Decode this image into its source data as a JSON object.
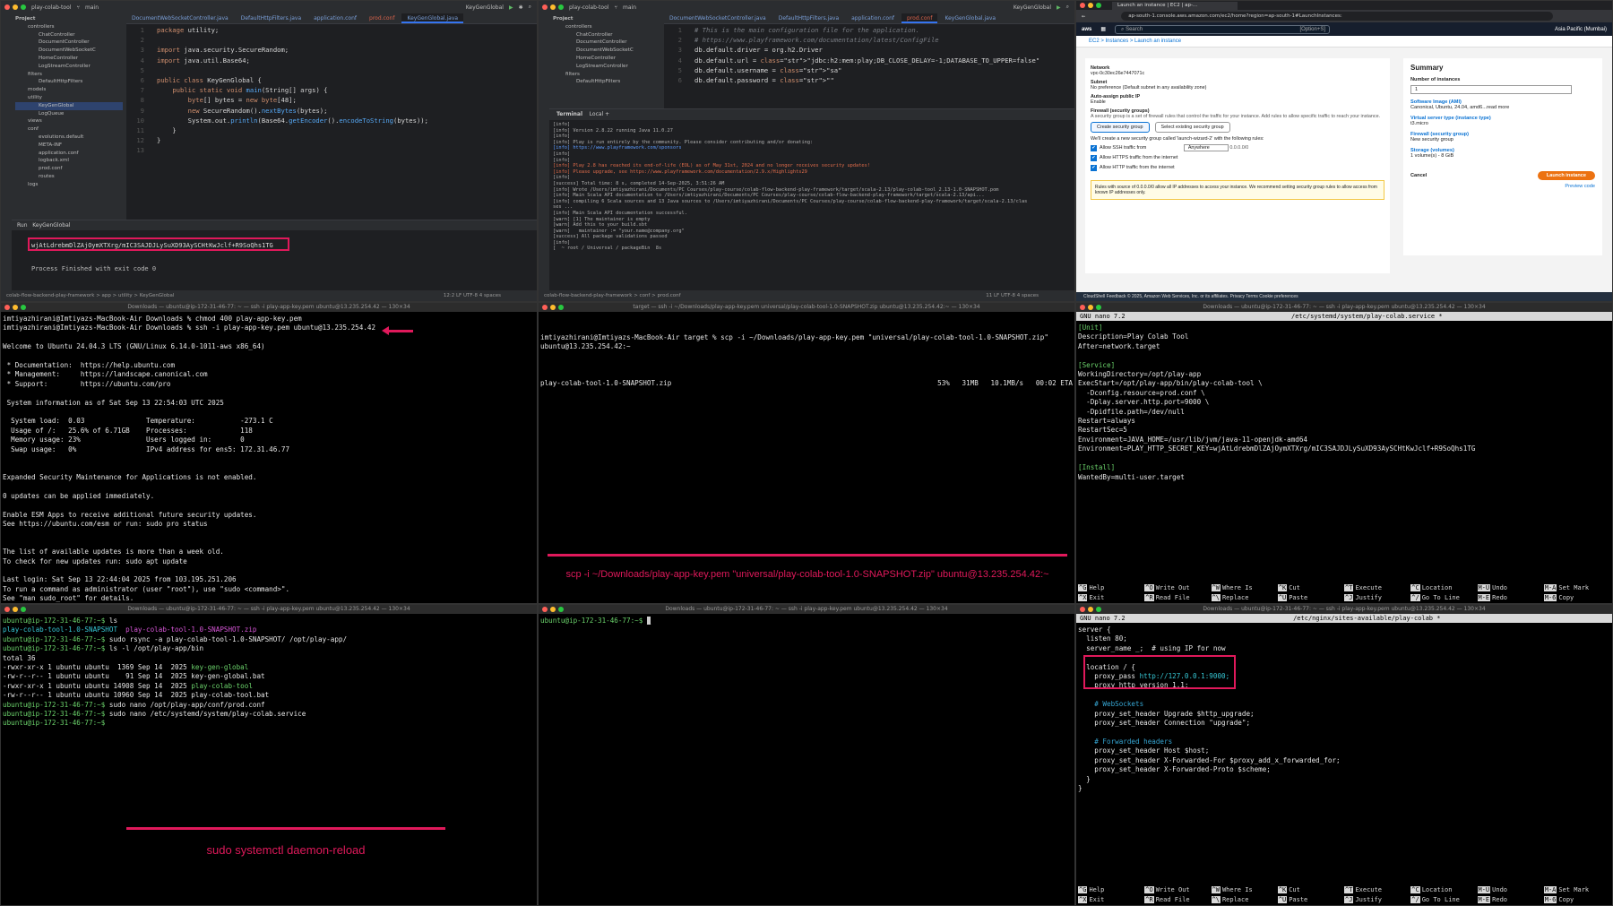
{
  "ide1": {
    "project": "play-colab-tool",
    "branch": "main",
    "run_config": "KeyGenGlobal",
    "tabs": [
      "DocumentWebSocketController.java",
      "DefaultHttpFilters.java",
      "application.conf",
      "prod.conf",
      "KeyGenGlobal.java"
    ],
    "tree_title": "Project",
    "tree": [
      "controllers",
      "ChatController",
      "DocumentController",
      "DocumentWebSocketC",
      "HomeController",
      "LogStreamController",
      "filters",
      "DefaultHttpFilters",
      "models",
      "utility",
      "KeyGenGlobal",
      "LogQueue",
      "views",
      "conf",
      "evolutions.default",
      "META-INF",
      "application.conf",
      "logback.xml",
      "prod.conf",
      "routes",
      "logs"
    ],
    "code": [
      {
        "n": "1",
        "t": "package utility;"
      },
      {
        "n": "2",
        "t": ""
      },
      {
        "n": "3",
        "t": "import java.security.SecureRandom;"
      },
      {
        "n": "4",
        "t": "import java.util.Base64;"
      },
      {
        "n": "5",
        "t": ""
      },
      {
        "n": "6",
        "t": "public class KeyGenGlobal {"
      },
      {
        "n": "7",
        "t": "    public static void main(String[] args) {"
      },
      {
        "n": "8",
        "t": "        byte[] bytes = new byte[48];"
      },
      {
        "n": "9",
        "t": "        new SecureRandom().nextBytes(bytes);"
      },
      {
        "n": "10",
        "t": "        System.out.println(Base64.getEncoder().encodeToString(bytes));"
      },
      {
        "n": "11",
        "t": "    }"
      },
      {
        "n": "12",
        "t": "}"
      },
      {
        "n": "13",
        "t": ""
      }
    ],
    "run_tab": "Run",
    "run_config_tab": "KeyGenGlobal",
    "output_key": "wjAtLdrebmDlZAjOymXTXrg/mIC3SAJDJLySuXD93AySCHtKwJclf+R9SoQhs1TG",
    "process_finished": "Process Finished with exit code 0",
    "status": "colab-flow-backend-play-framework > app > utility > KeyGenGlobal",
    "status_right": "12:2   LF   UTF-8   4 spaces"
  },
  "ide2": {
    "project": "play-colab-tool",
    "branch": "main",
    "run_config": "KeyGenGlobal",
    "tabs": [
      "DocumentWebSocketController.java",
      "DefaultHttpFilters.java",
      "application.conf",
      "prod.conf",
      "KeyGenGlobal.java"
    ],
    "tree_title": "Project",
    "tree": [
      "controllers",
      "ChatController",
      "DocumentController",
      "DocumentWebSocketC",
      "HomeController",
      "LogStreamController",
      "filters",
      "DefaultHttpFilters"
    ],
    "code": [
      {
        "n": "1",
        "t": "# This is the main configuration file for the application."
      },
      {
        "n": "2",
        "t": "# https://www.playframework.com/documentation/latest/ConfigFile"
      },
      {
        "n": "3",
        "t": "db.default.driver = org.h2.Driver"
      },
      {
        "n": "4",
        "t": "db.default.url = \"jdbc:h2:mem:play;DB_CLOSE_DELAY=-1;DATABASE_TO_UPPER=false\""
      },
      {
        "n": "5",
        "t": "db.default.username = \"sa\""
      },
      {
        "n": "6",
        "t": "db.default.password = \"\""
      }
    ],
    "terminal_tab": "Terminal",
    "local_tab": "Local",
    "term_lines": [
      "[info]",
      "[info] Version 2.8.22 running Java 11.0.27",
      "[info]",
      "[info] Play is run entirely by the community. Please consider contributing and/or donating:",
      "[info] https://www.playframework.com/sponsors",
      "[info]",
      "[info]",
      "[info] Play 2.8 has reached its end-of-life (EOL) as of May 31st, 2024 and no longer receives security updates!",
      "[info] Please upgrade, see https://www.playframework.com/documentation/2.9.x/Highlights29",
      "[info]",
      "[success] Total time: 8 s, completed 14-Sep-2025, 3:51:26 AM",
      "[info] Wrote /Users/imtiyazhirani/Documents/PC Courses/play-course/colab-flow-backend-play-framework/target/scala-2.13/play-colab-tool_2.13-1.0-SNAPSHOT.pom",
      "[info] Main Scala API documentation to /Users/imtiyazhirani/Documents/PC Courses/play-course/colab-flow-backend-play-framework/target/scala-2.13/api...",
      "[info] compiling 6 Scala sources and 13 Java sources to /Users/imtiyazhirani/Documents/PC Courses/play-course/colab-flow-backend-play-framework/target/scala-2.13/clas",
      "ses ...",
      "[info] Main Scala API documentation successful.",
      "[warn] [1] The maintainer is empty",
      "[warn] Add this to your build.sbt",
      "[warn]   maintainer := \"your.name@company.org\"",
      "[success] All package validations passed",
      "[info]",
      "[  ~ root / Universal / packageBin  8s"
    ],
    "status": "colab-flow-backend-play-framework > conf > prod.conf",
    "status_right": "11   LF   UTF-8   4 spaces"
  },
  "aws": {
    "tab_title": "Launch an instance | EC2 | ap-...",
    "url": "ap-south-1.console.aws.amazon.com/ec2/home?region=ap-south-1#LaunchInstances:",
    "search_placeholder": "Search",
    "search_shortcut": "[Option+S]",
    "region": "Asia Pacific (Mumbai)",
    "crumbs": "EC2  >  Instances  >  Launch an instance",
    "network_label": "Network",
    "network_value": "vpc-0c30ec26e7447071c",
    "subnet_label": "Subnet",
    "subnet_value": "No preference (Default subnet in any availability zone)",
    "public_ip_label": "Auto-assign public IP",
    "public_ip_value": "Enable",
    "firewall_label": "Firewall (security groups)",
    "firewall_desc": "A security group is a set of firewall rules that control the traffic for your instance. Add rules to allow specific traffic to reach your instance.",
    "sg_create": "Create security group",
    "sg_existing": "Select existing security group",
    "sg_note": "We'll create a new security group called 'launch-wizard-2' with the following rules:",
    "ssh_rule": "Allow SSH traffic from",
    "ssh_from": "Anywhere",
    "ssh_cidr": "0.0.0.0/0",
    "https_rule": "Allow HTTPS traffic from the internet",
    "http_rule": "Allow HTTP traffic from the internet",
    "warning": "Rules with source of 0.0.0.0/0 allow all IP addresses to access your instance. We recommend setting security group rules to allow access from known IP addresses only.",
    "summary_title": "Summary",
    "num_instances_label": "Number of instances",
    "num_instances": "1",
    "ami_label": "Software Image (AMI)",
    "ami_value": "Canonical, Ubuntu, 24.04, amd6...read more",
    "type_label": "Virtual server type (instance type)",
    "type_value": "t3.micro",
    "fw_label": "Firewall (security group)",
    "fw_value": "New security group",
    "storage_label": "Storage (volumes)",
    "storage_value": "1 volume(s) - 8 GiB",
    "cancel": "Cancel",
    "launch": "Launch instance",
    "preview": "Preview code",
    "footer": "CloudShell    Feedback                                       © 2025, Amazon Web Services, Inc. or its affiliates.    Privacy    Terms    Cookie preferences"
  },
  "t1": {
    "title": "Downloads — ubuntu@ip-172-31-46-77: ~ — ssh -i play-app-key.pem ubuntu@13.235.254.42 — 130×34",
    "lines": [
      "imtiyazhirani@Imtiyazs-MacBook-Air Downloads % chmod 400 play-app-key.pem",
      "imtiyazhirani@Imtiyazs-MacBook-Air Downloads % ssh -i play-app-key.pem ubuntu@13.235.254.42",
      "",
      "Welcome to Ubuntu 24.04.3 LTS (GNU/Linux 6.14.0-1011-aws x86_64)",
      "",
      " * Documentation:  https://help.ubuntu.com",
      " * Management:     https://landscape.canonical.com",
      " * Support:        https://ubuntu.com/pro",
      "",
      " System information as of Sat Sep 13 22:54:03 UTC 2025",
      "",
      "  System load:  0.03               Temperature:           -273.1 C",
      "  Usage of /:   25.6% of 6.71GB    Processes:             118",
      "  Memory usage: 23%                Users logged in:       0",
      "  Swap usage:   0%                 IPv4 address for ens5: 172.31.46.77",
      "",
      "",
      "Expanded Security Maintenance for Applications is not enabled.",
      "",
      "0 updates can be applied immediately.",
      "",
      "Enable ESM Apps to receive additional future security updates.",
      "See https://ubuntu.com/esm or run: sudo pro status",
      "",
      "",
      "The list of available updates is more than a week old.",
      "To check for new updates run: sudo apt update",
      "",
      "Last login: Sat Sep 13 22:44:04 2025 from 103.195.251.206",
      "To run a command as administrator (user \"root\"), use \"sudo <command>\".",
      "See \"man sudo_root\" for details.",
      "",
      "ubuntu@ip-172-31-46-77:~$ "
    ]
  },
  "t2": {
    "title": "target — ssh -i ~/Downloads/play-app-key.pem universal/play-colab-tool-1.0-SNAPSHOT.zip ubuntu@13.235.254.42:~ — 130×34",
    "cmd": "imtiyazhirani@Imtiyazs-MacBook-Air target % scp -i ~/Downloads/play-app-key.pem \"universal/play-colab-tool-1.0-SNAPSHOT.zip\" ubuntu@13.235.254.42:~",
    "file": "play-colab-tool-1.0-SNAPSHOT.zip",
    "progress": "53%   31MB   10.1MB/s   00:02 ETA",
    "caption": "scp -i ~/Downloads/play-app-key.pem \"universal/play-colab-tool-1.0-SNAPSHOT.zip\" ubuntu@13.235.254.42:~"
  },
  "t3": {
    "title": "Downloads — ubuntu@ip-172-31-46-77: ~ — ssh -i play-app-key.pem ubuntu@13.235.254.42 — 130×34",
    "nano_version": "GNU nano 7.2",
    "file": "/etc/systemd/system/play-colab.service *",
    "lines": [
      {
        "c": "sec",
        "t": "[Unit]"
      },
      {
        "c": "",
        "t": "Description=Play Colab Tool"
      },
      {
        "c": "",
        "t": "After=network.target"
      },
      {
        "c": "",
        "t": ""
      },
      {
        "c": "sec",
        "t": "[Service]"
      },
      {
        "c": "",
        "t": "WorkingDirectory=/opt/play-app"
      },
      {
        "c": "",
        "t": "ExecStart=/opt/play-app/bin/play-colab-tool \\"
      },
      {
        "c": "",
        "t": "  -Dconfig.resource=prod.conf \\"
      },
      {
        "c": "",
        "t": "  -Dplay.server.http.port=9000 \\"
      },
      {
        "c": "",
        "t": "  -Dpidfile.path=/dev/null"
      },
      {
        "c": "",
        "t": "Restart=always"
      },
      {
        "c": "",
        "t": "RestartSec=5"
      },
      {
        "c": "",
        "t": "Environment=JAVA_HOME=/usr/lib/jvm/java-11-openjdk-amd64"
      },
      {
        "c": "",
        "t": "Environment=PLAY_HTTP_SECRET_KEY=wjAtLdrebmDlZAjOymXTXrg/mIC3SAJDJLySuXD93AySCHtKwJclf+R9SoQhs1TG"
      },
      {
        "c": "",
        "t": ""
      },
      {
        "c": "sec",
        "t": "[Install]"
      },
      {
        "c": "",
        "t": "WantedBy=multi-user.target"
      }
    ]
  },
  "t4": {
    "title": "Downloads — ubuntu@ip-172-31-46-77: ~ — ssh -i play-app-key.pem ubuntu@13.235.254.42 — 130×34",
    "lines": [
      {
        "p": "ubuntu@ip-172-31-46-77:~$ ",
        "t": "ls"
      },
      {
        "p": "",
        "t": "",
        "ls": true
      },
      {
        "p": "ubuntu@ip-172-31-46-77:~$ ",
        "t": "sudo rsync -a play-colab-tool-1.0-SNAPSHOT/ /opt/play-app/"
      },
      {
        "p": "ubuntu@ip-172-31-46-77:~$ ",
        "t": "ls -l /opt/play-app/bin"
      },
      {
        "p": "",
        "t": "total 36"
      },
      {
        "p": "",
        "t": "-rwxr-xr-x 1 ubuntu ubuntu  1369 Sep 14  2025 ",
        "g": "key-gen-global"
      },
      {
        "p": "",
        "t": "-rw-r--r-- 1 ubuntu ubuntu    91 Sep 14  2025 key-gen-global.bat"
      },
      {
        "p": "",
        "t": "-rwxr-xr-x 1 ubuntu ubuntu 14908 Sep 14  2025 ",
        "g": "play-colab-tool"
      },
      {
        "p": "",
        "t": "-rw-r--r-- 1 ubuntu ubuntu 10960 Sep 14  2025 play-colab-tool.bat"
      },
      {
        "p": "ubuntu@ip-172-31-46-77:~$ ",
        "t": "sudo nano /opt/play-app/conf/prod.conf"
      },
      {
        "p": "ubuntu@ip-172-31-46-77:~$ ",
        "t": "sudo nano /etc/systemd/system/play-colab.service"
      },
      {
        "p": "ubuntu@ip-172-31-46-77:~$ ",
        "t": ""
      }
    ],
    "ls_dir": "play-colab-tool-1.0-SNAPSHOT",
    "ls_zip": "play-colab-tool-1.0-SNAPSHOT.zip",
    "caption": "sudo systemctl daemon-reload"
  },
  "t5": {
    "title": "Downloads — ubuntu@ip-172-31-46-77: ~ — ssh -i play-app-key.pem ubuntu@13.235.254.42 — 130×34",
    "prompt": "ubuntu@ip-172-31-46-77:~$ "
  },
  "t6": {
    "title": "Downloads — ubuntu@ip-172-31-46-77: ~ — ssh -i play-app-key.pem ubuntu@13.235.254.42 — 130×34",
    "nano_version": "GNU nano 7.2",
    "file": "/etc/nginx/sites-available/play-colab *",
    "lines": [
      {
        "c": "",
        "t": "server {"
      },
      {
        "c": "",
        "t": "  listen 80;"
      },
      {
        "c": "",
        "t": "  server_name _;  # using IP for now"
      },
      {
        "c": "",
        "t": ""
      },
      {
        "c": "",
        "t": "  location / {"
      },
      {
        "c": "",
        "t": "    proxy_pass http://127.0.0.1:9000;"
      },
      {
        "c": "",
        "t": "    proxy_http_version 1.1;"
      },
      {
        "c": "",
        "t": ""
      },
      {
        "c": "ncm",
        "t": "    # WebSockets"
      },
      {
        "c": "",
        "t": "    proxy_set_header Upgrade $http_upgrade;"
      },
      {
        "c": "",
        "t": "    proxy_set_header Connection \"upgrade\";"
      },
      {
        "c": "",
        "t": ""
      },
      {
        "c": "ncm",
        "t": "    # Forwarded headers"
      },
      {
        "c": "",
        "t": "    proxy_set_header Host $host;"
      },
      {
        "c": "",
        "t": "    proxy_set_header X-Forwarded-For $proxy_add_x_forwarded_for;"
      },
      {
        "c": "",
        "t": "    proxy_set_header X-Forwarded-Proto $scheme;"
      },
      {
        "c": "",
        "t": "  }"
      },
      {
        "c": "",
        "t": "}"
      }
    ]
  },
  "nano_keys": [
    {
      "k": "^G",
      "l": "Help"
    },
    {
      "k": "^O",
      "l": "Write Out"
    },
    {
      "k": "^W",
      "l": "Where Is"
    },
    {
      "k": "^K",
      "l": "Cut"
    },
    {
      "k": "^T",
      "l": "Execute"
    },
    {
      "k": "^C",
      "l": "Location"
    },
    {
      "k": "M-U",
      "l": "Undo"
    },
    {
      "k": "M-A",
      "l": "Set Mark"
    },
    {
      "k": "^X",
      "l": "Exit"
    },
    {
      "k": "^R",
      "l": "Read File"
    },
    {
      "k": "^\\",
      "l": "Replace"
    },
    {
      "k": "^U",
      "l": "Paste"
    },
    {
      "k": "^J",
      "l": "Justify"
    },
    {
      "k": "^/",
      "l": "Go To Line"
    },
    {
      "k": "M-E",
      "l": "Redo"
    },
    {
      "k": "M-6",
      "l": "Copy"
    }
  ],
  "colors": {
    "highlight": "#e0195b",
    "aws_orange": "#ec7211",
    "aws_blue": "#0972d3"
  }
}
